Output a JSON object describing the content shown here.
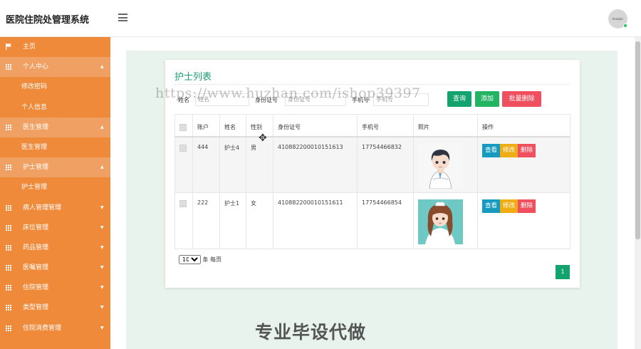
{
  "header": {
    "title": "医院住院处管理系统",
    "avatar_text": "headpic"
  },
  "sidebar": {
    "items": [
      {
        "label": "主页",
        "type": "home"
      },
      {
        "label": "个人中心",
        "type": "group",
        "open": true,
        "caret": "▲"
      },
      {
        "label": "修改密码",
        "type": "sub"
      },
      {
        "label": "个人信息",
        "type": "sub"
      },
      {
        "label": "医生管理",
        "type": "group",
        "open": true,
        "caret": "▲"
      },
      {
        "label": "医生管理",
        "type": "sub"
      },
      {
        "label": "护士管理",
        "type": "group",
        "open": true,
        "caret": "▲"
      },
      {
        "label": "护士管理",
        "type": "sub"
      },
      {
        "label": "病人管理管理",
        "type": "group",
        "caret": "▼"
      },
      {
        "label": "床位管理",
        "type": "group",
        "caret": "▼"
      },
      {
        "label": "药品管理",
        "type": "group",
        "caret": "▼"
      },
      {
        "label": "医嘱管理",
        "type": "group",
        "caret": "▼"
      },
      {
        "label": "住院管理",
        "type": "group",
        "caret": "▼"
      },
      {
        "label": "类型管理",
        "type": "group",
        "caret": "▼"
      },
      {
        "label": "住院消费管理",
        "type": "group",
        "caret": "▼"
      }
    ]
  },
  "main": {
    "title": "护士列表",
    "search": {
      "name_label": "姓名",
      "name_placeholder": "姓名",
      "id_label": "身份证号",
      "id_placeholder": "身份证号",
      "phone_label": "手机号",
      "phone_placeholder": "手机号"
    },
    "buttons": {
      "search": "查询",
      "add": "添加",
      "batch_delete": "批量删除"
    },
    "table": {
      "columns": [
        "账户",
        "姓名",
        "性别",
        "身份证号",
        "手机号",
        "照片",
        "操作"
      ],
      "rows": [
        {
          "account": "444",
          "name": "护士4",
          "gender": "男",
          "id_card": "410882200010151613",
          "phone": "17754466832",
          "photo": "male-nurse-cartoon"
        },
        {
          "account": "222",
          "name": "护士1",
          "gender": "女",
          "id_card": "410882200010151611",
          "phone": "17754466854",
          "photo": "female-nurse-cartoon"
        }
      ],
      "actions": {
        "view": "查看",
        "edit": "修改",
        "delete": "删除"
      }
    },
    "pager": {
      "page_size": "10",
      "per_page_text": "条 每页",
      "current_page": "1"
    }
  },
  "overlay": {
    "watermark_url": "https://www.huzhan.com/ishop39397",
    "promo_text": "专业毕设代做"
  },
  "colors": {
    "sidebar": "#ef8a3a",
    "accent": "#14a36e",
    "danger": "#ef4f5e",
    "warning": "#f0ac13",
    "info": "#179ac0"
  }
}
